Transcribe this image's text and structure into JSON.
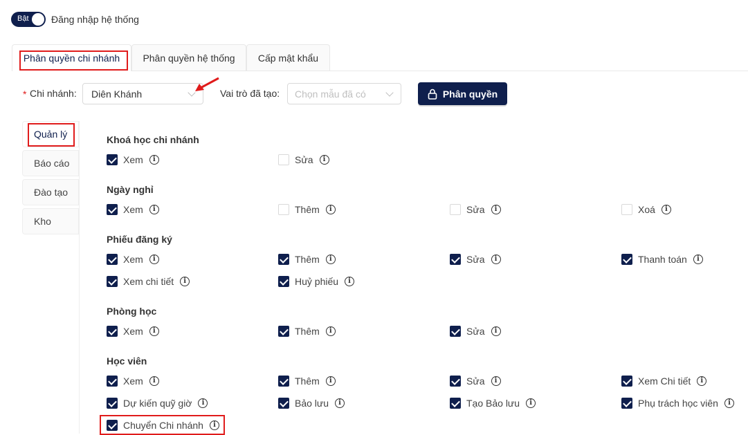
{
  "header": {
    "toggle_label": "Bật",
    "login_label": "Đăng nhập hệ thống"
  },
  "tabs": [
    "Phân quyền chi nhánh",
    "Phân quyền hệ thống",
    "Cấp mật khẩu"
  ],
  "filters": {
    "required_mark": "*",
    "branch_label": "Chi nhánh:",
    "branch_value": "Diên Khánh",
    "role_label": "Vai trò đã tạo:",
    "role_placeholder": "Chọn mẫu đã có",
    "permission_button": "Phân quyền"
  },
  "side_tabs": [
    "Quản lý",
    "Báo cáo",
    "Đào tạo",
    "Kho"
  ],
  "sections": [
    {
      "title": "Khoá học chi nhánh",
      "items": [
        {
          "label": "Xem",
          "checked": true
        },
        {
          "label": "Sửa",
          "checked": false
        }
      ]
    },
    {
      "title": "Ngày nghỉ",
      "items": [
        {
          "label": "Xem",
          "checked": true
        },
        {
          "label": "Thêm",
          "checked": false
        },
        {
          "label": "Sửa",
          "checked": false
        },
        {
          "label": "Xoá",
          "checked": false
        }
      ]
    },
    {
      "title": "Phiếu đăng ký",
      "items": [
        {
          "label": "Xem",
          "checked": true
        },
        {
          "label": "Thêm",
          "checked": true
        },
        {
          "label": "Sửa",
          "checked": true
        },
        {
          "label": "Thanh toán",
          "checked": true
        },
        {
          "label": "Xem chi tiết",
          "checked": true
        },
        {
          "label": "Huỷ phiếu",
          "checked": true
        }
      ]
    },
    {
      "title": "Phòng học",
      "items": [
        {
          "label": "Xem",
          "checked": true
        },
        {
          "label": "Thêm",
          "checked": true
        },
        {
          "label": "Sửa",
          "checked": true
        }
      ]
    },
    {
      "title": "Học viên",
      "items": [
        {
          "label": "Xem",
          "checked": true
        },
        {
          "label": "Thêm",
          "checked": true
        },
        {
          "label": "Sửa",
          "checked": true
        },
        {
          "label": "Xem Chi tiết",
          "checked": true
        },
        {
          "label": "Dự kiến quỹ giờ",
          "checked": true
        },
        {
          "label": "Bảo lưu",
          "checked": true
        },
        {
          "label": "Tạo Bảo lưu",
          "checked": true
        },
        {
          "label": "Phụ trách học viên",
          "checked": true
        },
        {
          "label": "Chuyển Chi nhánh",
          "checked": true
        }
      ]
    }
  ],
  "icons": {
    "info": "info-icon",
    "lock": "lock-icon",
    "chevron": "chevron-down-icon",
    "check": "check-icon"
  },
  "colors": {
    "primary": "#0f1f4d",
    "highlight": "#e01b1b"
  }
}
